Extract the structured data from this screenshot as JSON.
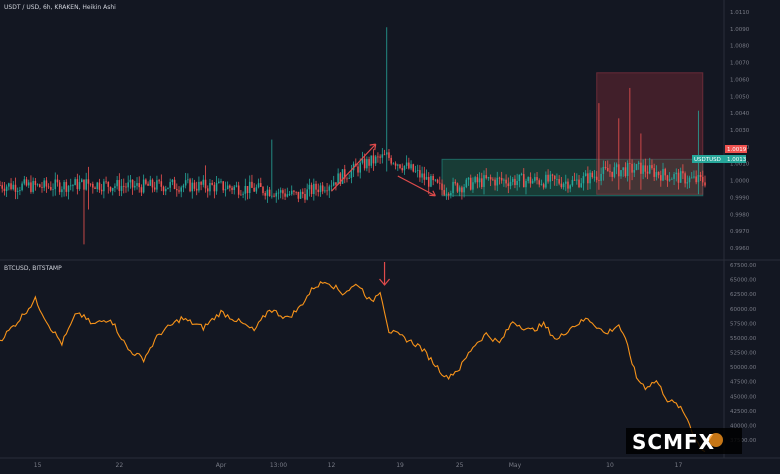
{
  "colors": {
    "background": "#131722",
    "up": "#26a69a",
    "down": "#ef5350",
    "line": "#f7931a",
    "annotation": "#e04b4b",
    "grid": "#1e222d",
    "zone_green": "#1f6b4f",
    "zone_red": "#7a2a35"
  },
  "panes": {
    "top_title": "USDT / USD, 6h, KRAKEN, Heikin Ashi",
    "bottom_title": "BTCUSD, BITSTAMP"
  },
  "price_tags": {
    "upper": "1.0019",
    "lower_left": "USDTUSD",
    "lower": "1.0013"
  },
  "watermark": "SCMFX",
  "chart_data": [
    {
      "type": "candlestick",
      "title": "USDT / USD, 6h, KRAKEN, Heikin Ashi",
      "y_ticks": [
        "1.0110",
        "1.0090",
        "1.0080",
        "1.0070",
        "1.0060",
        "1.0050",
        "1.0040",
        "1.0030",
        "1.0020",
        "1.0010",
        "1.0000",
        "0.9990",
        "0.9980",
        "0.9970",
        "0.9960"
      ],
      "ylim": [
        0.9955,
        1.0115
      ],
      "grid": false,
      "series": [
        {
          "name": "USDTUSD",
          "keypoints": [
            {
              "i": 0,
              "c": 1.0001
            },
            {
              "i": 20,
              "c": 1.0
            },
            {
              "i": 40,
              "c": 1.0002
            },
            {
              "i": 60,
              "c": 1.0
            },
            {
              "i": 80,
              "c": 1.0001
            },
            {
              "i": 100,
              "c": 1.0
            },
            {
              "i": 120,
              "c": 0.9998
            },
            {
              "i": 135,
              "c": 0.9994
            },
            {
              "i": 150,
              "c": 1.0003
            },
            {
              "i": 165,
              "c": 1.0015
            },
            {
              "i": 175,
              "c": 1.002
            },
            {
              "i": 185,
              "c": 1.0012
            },
            {
              "i": 200,
              "c": 0.9998
            },
            {
              "i": 220,
              "c": 1.0004
            },
            {
              "i": 240,
              "c": 1.0004
            },
            {
              "i": 260,
              "c": 1.0003
            },
            {
              "i": 275,
              "c": 1.001
            },
            {
              "i": 290,
              "c": 1.0012
            },
            {
              "i": 300,
              "c": 1.0008
            },
            {
              "i": 315,
              "c": 1.0004
            }
          ],
          "spikes": [
            {
              "i": 40,
              "high": 1.0013,
              "low": 0.9985
            },
            {
              "i": 93,
              "high": 1.0014,
              "low": 0.9997
            },
            {
              "i": 123,
              "high": 1.0031,
              "low": 0.9998
            },
            {
              "i": 175,
              "high": 1.0105,
              "low": 1.001
            },
            {
              "i": 271,
              "high": 1.0055,
              "low": 0.9998
            },
            {
              "i": 280,
              "high": 1.0045,
              "low": 0.9998
            },
            {
              "i": 285,
              "high": 1.0065,
              "low": 0.9998
            },
            {
              "i": 290,
              "high": 1.0035,
              "low": 0.9998
            },
            {
              "i": 316,
              "high": 1.005,
              "low": 0.9995
            },
            {
              "i": 38,
              "high": 1.0003,
              "low": 0.9962
            }
          ]
        }
      ],
      "zones": [
        {
          "color": "green",
          "x0": 200,
          "x1": 318,
          "y0": 0.9994,
          "y1": 1.0018
        },
        {
          "color": "red",
          "x0": 270,
          "x1": 318,
          "y0": 0.9995,
          "y1": 1.0075
        }
      ]
    },
    {
      "type": "line",
      "title": "BTCUSD, BITSTAMP",
      "y_ticks": [
        "67500.00",
        "65000.00",
        "62500.00",
        "60000.00",
        "57500.00",
        "55000.00",
        "52500.00",
        "50000.00",
        "47500.00",
        "45000.00",
        "42500.00",
        "40000.00",
        "37500.00"
      ],
      "ylim": [
        36500,
        67500
      ],
      "grid": false,
      "series": [
        {
          "name": "BTCUSD",
          "keypoints": [
            {
              "i": 0,
              "v": 55000
            },
            {
              "i": 8,
              "v": 58000
            },
            {
              "i": 16,
              "v": 61500
            },
            {
              "i": 22,
              "v": 57500
            },
            {
              "i": 28,
              "v": 54500
            },
            {
              "i": 35,
              "v": 59500
            },
            {
              "i": 42,
              "v": 57500
            },
            {
              "i": 50,
              "v": 58500
            },
            {
              "i": 58,
              "v": 53500
            },
            {
              "i": 65,
              "v": 52000
            },
            {
              "i": 72,
              "v": 56000
            },
            {
              "i": 82,
              "v": 58500
            },
            {
              "i": 92,
              "v": 57000
            },
            {
              "i": 100,
              "v": 59500
            },
            {
              "i": 108,
              "v": 58000
            },
            {
              "i": 115,
              "v": 56500
            },
            {
              "i": 122,
              "v": 60000
            },
            {
              "i": 130,
              "v": 58500
            },
            {
              "i": 135,
              "v": 60000
            },
            {
              "i": 142,
              "v": 63500
            },
            {
              "i": 148,
              "v": 64500
            },
            {
              "i": 155,
              "v": 62500
            },
            {
              "i": 162,
              "v": 64000
            },
            {
              "i": 168,
              "v": 61000
            },
            {
              "i": 172,
              "v": 63000
            },
            {
              "i": 176,
              "v": 56500
            },
            {
              "i": 182,
              "v": 55500
            },
            {
              "i": 190,
              "v": 54000
            },
            {
              "i": 196,
              "v": 51500
            },
            {
              "i": 202,
              "v": 49000
            },
            {
              "i": 208,
              "v": 50500
            },
            {
              "i": 214,
              "v": 54000
            },
            {
              "i": 220,
              "v": 56000
            },
            {
              "i": 226,
              "v": 54500
            },
            {
              "i": 232,
              "v": 58000
            },
            {
              "i": 240,
              "v": 56500
            },
            {
              "i": 246,
              "v": 57500
            },
            {
              "i": 252,
              "v": 55000
            },
            {
              "i": 258,
              "v": 57000
            },
            {
              "i": 266,
              "v": 58500
            },
            {
              "i": 274,
              "v": 56000
            },
            {
              "i": 280,
              "v": 57500
            },
            {
              "i": 284,
              "v": 54000
            },
            {
              "i": 288,
              "v": 49000
            },
            {
              "i": 292,
              "v": 47500
            },
            {
              "i": 297,
              "v": 48500
            },
            {
              "i": 302,
              "v": 45500
            },
            {
              "i": 307,
              "v": 44500
            },
            {
              "i": 311,
              "v": 42500
            },
            {
              "i": 315,
              "v": 39000
            },
            {
              "i": 318,
              "v": 37500
            }
          ]
        }
      ]
    }
  ],
  "x_ticks": [
    {
      "i": 17,
      "label": "15"
    },
    {
      "i": 54,
      "label": "22"
    },
    {
      "i": 100,
      "label": "Apr"
    },
    {
      "i": 126,
      "label": "13:00"
    },
    {
      "i": 150,
      "label": "12"
    },
    {
      "i": 181,
      "label": "19"
    },
    {
      "i": 208,
      "label": "25"
    },
    {
      "i": 233,
      "label": "May"
    },
    {
      "i": 276,
      "label": "10"
    },
    {
      "i": 307,
      "label": "17"
    }
  ]
}
